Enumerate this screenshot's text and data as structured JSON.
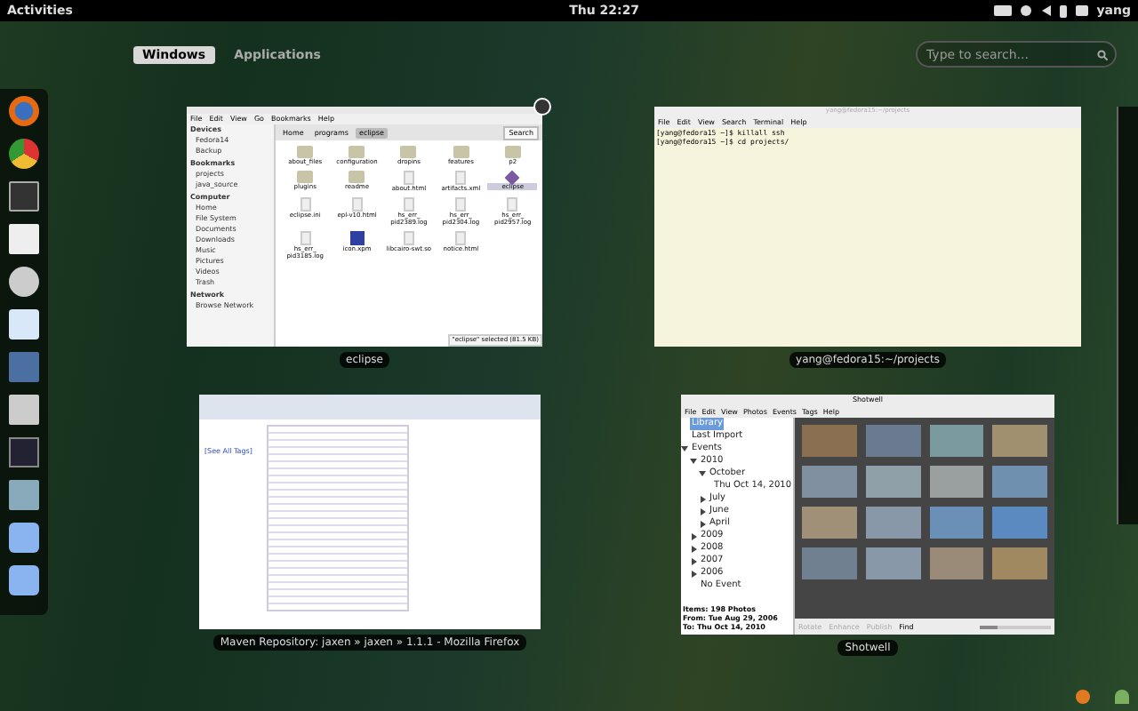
{
  "top_bar": {
    "activities": "Activities",
    "clock": "Thu 22:27",
    "user": "yang"
  },
  "tabs": [
    {
      "label": "Windows",
      "selected": true
    },
    {
      "label": "Applications",
      "selected": false
    }
  ],
  "search": {
    "placeholder": "Type to search..."
  },
  "file_manager": {
    "caption": "eclipse",
    "menu": [
      "File",
      "Edit",
      "View",
      "Go",
      "Bookmarks",
      "Help"
    ],
    "path": [
      {
        "label": "Home",
        "selected": false
      },
      {
        "label": "programs",
        "selected": false
      },
      {
        "label": "eclipse",
        "selected": true
      }
    ],
    "search_button": "Search",
    "sidebar": [
      {
        "heading": "Devices",
        "items": [
          "Fedora14",
          "Backup"
        ]
      },
      {
        "heading": "Bookmarks",
        "items": [
          "projects",
          "java_source"
        ]
      },
      {
        "heading": "Computer",
        "items": [
          "Home",
          "File System",
          "Documents",
          "Downloads",
          "Music",
          "Pictures",
          "Videos",
          "Trash"
        ]
      },
      {
        "heading": "Network",
        "items": [
          "Browse Network"
        ]
      }
    ],
    "files": [
      {
        "name": "about_files",
        "kind": "folder",
        "selected": false
      },
      {
        "name": "configuration",
        "kind": "folder",
        "selected": false
      },
      {
        "name": "dropins",
        "kind": "folder",
        "selected": false
      },
      {
        "name": "features",
        "kind": "folder",
        "selected": false
      },
      {
        "name": "p2",
        "kind": "folder",
        "selected": false
      },
      {
        "name": "plugins",
        "kind": "folder",
        "selected": false
      },
      {
        "name": "readme",
        "kind": "folder",
        "selected": false
      },
      {
        "name": "about.html",
        "kind": "file",
        "selected": false
      },
      {
        "name": "artifacts.xml",
        "kind": "file",
        "selected": false
      },
      {
        "name": "eclipse",
        "kind": "app",
        "selected": true
      },
      {
        "name": "eclipse.ini",
        "kind": "file",
        "selected": false
      },
      {
        "name": "epl-v10.html",
        "kind": "file",
        "selected": false
      },
      {
        "name": "hs_err_ pid2389.log",
        "kind": "file",
        "selected": false
      },
      {
        "name": "hs_err_ pid2304.log",
        "kind": "file",
        "selected": false
      },
      {
        "name": "hs_err_ pid2957.log",
        "kind": "file",
        "selected": false
      },
      {
        "name": "hs_err_ pid3185.log",
        "kind": "file",
        "selected": false
      },
      {
        "name": "icon.xpm",
        "kind": "image",
        "selected": false
      },
      {
        "name": "libcairo-swt.so",
        "kind": "file",
        "selected": false
      },
      {
        "name": "notice.html",
        "kind": "file",
        "selected": false
      }
    ],
    "status": "\"eclipse\" selected (81.5 KB)"
  },
  "terminal": {
    "title": "yang@fedora15:~/projects",
    "caption": "yang@fedora15:~/projects",
    "menu": [
      "File",
      "Edit",
      "View",
      "Search",
      "Terminal",
      "Help"
    ],
    "lines": [
      "[yang@fedora15 ~]$ killall ssh",
      "[yang@fedora15 ~]$ cd projects/"
    ]
  },
  "browser": {
    "caption": "Maven Repository: jaxen » jaxen » 1.1.1 - Mozilla Firefox",
    "side_link": "[See All Tags]"
  },
  "photo_app": {
    "title": "Shotwell",
    "caption": "Shotwell",
    "menu": [
      "File",
      "Edit",
      "View",
      "Photos",
      "Events",
      "Tags",
      "Help"
    ],
    "tree": [
      {
        "label": "Library",
        "selected": true
      },
      {
        "label": "Last Import",
        "selected": false
      },
      {
        "label": "Events",
        "selected": false,
        "expanded": true,
        "children": [
          {
            "label": "2010",
            "selected": false,
            "expanded": true,
            "children": [
              {
                "label": "October",
                "selected": false,
                "expanded": true,
                "children": [
                  {
                    "label": "Thu Oct 14, 2010",
                    "selected": false
                  }
                ]
              },
              {
                "label": "July",
                "selected": false,
                "expanded": false
              },
              {
                "label": "June",
                "selected": false,
                "expanded": false
              },
              {
                "label": "April",
                "selected": false,
                "expanded": false
              }
            ]
          },
          {
            "label": "2009",
            "selected": false,
            "expanded": false
          },
          {
            "label": "2008",
            "selected": false,
            "expanded": false
          },
          {
            "label": "2007",
            "selected": false,
            "expanded": false
          },
          {
            "label": "2006",
            "selected": false,
            "expanded": false
          },
          {
            "label": "No Event",
            "selected": false
          }
        ]
      }
    ],
    "stats": [
      "Items: 198 Photos",
      "From: Tue Aug 29, 2006",
      "To: Thu Oct 14, 2010"
    ],
    "toolbar": [
      "Rotate",
      "Enhance",
      "Publish",
      "Find"
    ],
    "zoom": {
      "level": 0.25
    }
  }
}
